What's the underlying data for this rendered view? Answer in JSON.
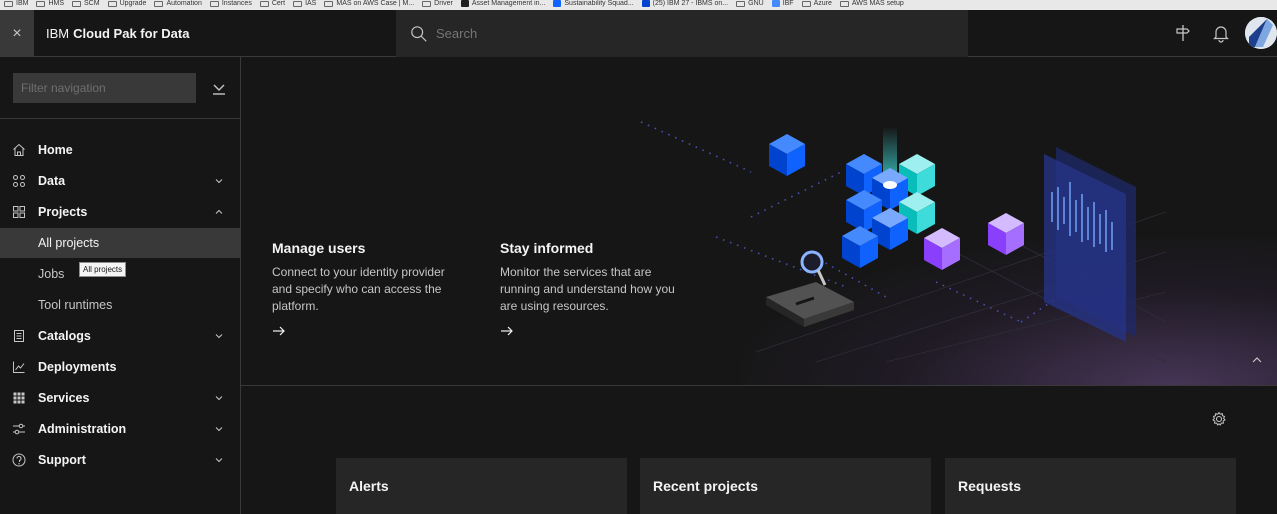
{
  "bookmarks": [
    {
      "label": "IBM",
      "icon": "folder-icon"
    },
    {
      "label": "HMS",
      "icon": "folder-icon"
    },
    {
      "label": "SCM",
      "icon": "folder-icon"
    },
    {
      "label": "Upgrade",
      "icon": "folder-icon"
    },
    {
      "label": "Automation",
      "icon": "folder-icon"
    },
    {
      "label": "Instances",
      "icon": "folder-icon"
    },
    {
      "label": "Cert",
      "icon": "folder-icon"
    },
    {
      "label": "IAS",
      "icon": "folder-icon"
    },
    {
      "label": "MAS on AWS Case | M...",
      "icon": "folder-icon"
    },
    {
      "label": "Driver",
      "icon": "folder-icon"
    },
    {
      "label": "Asset Management in...",
      "icon": "favicon"
    },
    {
      "label": "Sustainability Squad...",
      "icon": "favicon"
    },
    {
      "label": "(25) IBM 27 - IBMS on...",
      "icon": "favicon"
    },
    {
      "label": "GNU",
      "icon": "folder-icon"
    },
    {
      "label": "IBF",
      "icon": "favicon"
    },
    {
      "label": "Azure",
      "icon": "folder-icon"
    },
    {
      "label": "AWS MAS setup",
      "icon": "folder-icon"
    }
  ],
  "header": {
    "brand_prefix": "IBM",
    "brand_name": "Cloud Pak for Data",
    "search_placeholder": "Search",
    "close_glyph": "×"
  },
  "sidebar": {
    "filter_placeholder": "Filter navigation",
    "items": [
      {
        "label": "Home",
        "icon": "home-icon"
      },
      {
        "label": "Data",
        "icon": "data-icon",
        "expandable": true,
        "expanded": false
      },
      {
        "label": "Projects",
        "icon": "projects-icon",
        "expandable": true,
        "expanded": true
      },
      {
        "label": "Catalogs",
        "icon": "catalog-icon",
        "expandable": true,
        "expanded": false
      },
      {
        "label": "Deployments",
        "icon": "deployments-icon"
      },
      {
        "label": "Services",
        "icon": "services-icon",
        "expandable": true,
        "expanded": false
      },
      {
        "label": "Administration",
        "icon": "administration-icon",
        "expandable": true,
        "expanded": false
      },
      {
        "label": "Support",
        "icon": "help-icon",
        "expandable": true,
        "expanded": false
      }
    ],
    "project_children": [
      {
        "label": "All projects",
        "active": true
      },
      {
        "label": "Jobs"
      },
      {
        "label": "Tool runtimes"
      }
    ],
    "tooltip": "All projects"
  },
  "hero": {
    "cards": [
      {
        "title": "Manage users",
        "description": "Connect to your identity provider and specify who can access the platform."
      },
      {
        "title": "Stay informed",
        "description": "Monitor the services that are running and understand how you are using resources."
      }
    ]
  },
  "tiles": [
    {
      "title": "Alerts"
    },
    {
      "title": "Recent projects"
    },
    {
      "title": "Requests"
    }
  ],
  "colors": {
    "background": "#161616",
    "panel": "#262626",
    "active": "#393939",
    "cube_blue": "#0f62fe",
    "cube_teal": "#3ddbd9",
    "cube_purple": "#8a3ffc"
  }
}
